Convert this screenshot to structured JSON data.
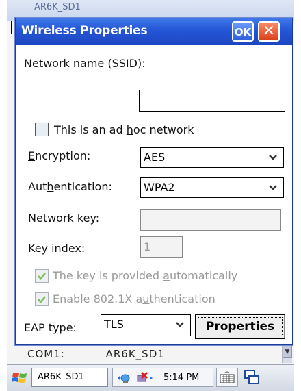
{
  "background_window": {
    "title": "AR6K_SD1",
    "list_row": [
      "COM1:",
      "AR6K_SD1"
    ]
  },
  "dialog": {
    "title": "Wireless Properties",
    "ok_label": "OK",
    "close_glyph": "✕",
    "ssid_label_pre": "Network ",
    "ssid_label_u": "n",
    "ssid_label_post": "ame (SSID):",
    "ssid_value": "",
    "adhoc_pre": "This is an ad ",
    "adhoc_u": "h",
    "adhoc_post": "oc network",
    "adhoc_checked": false,
    "encryption_u": "E",
    "encryption_post": "ncryption:",
    "encryption_value": "AES",
    "auth_pre": "Aut",
    "auth_u": "h",
    "auth_post": "entication:",
    "auth_value": "WPA2",
    "netkey_pre": "Network ",
    "netkey_u": "k",
    "netkey_post": "ey:",
    "netkey_value": "",
    "keyindex_pre": "Key inde",
    "keyindex_u": "x",
    "keyindex_post": ":",
    "keyindex_value": "1",
    "auto_pre": "The key is provided ",
    "auto_u": "a",
    "auto_post": "utomatically",
    "auto_checked": true,
    "eap8021x_pre": "Enable 802.1X a",
    "eap8021x_u": "u",
    "eap8021x_post": "thentication",
    "eap8021x_checked": true,
    "eaptype_label": "EAP type:",
    "eaptype_value": "TLS",
    "properties_u": "P",
    "properties_post": "roperties"
  },
  "taskbar": {
    "task_label": "AR6K_SD1",
    "time": "5:14 PM"
  },
  "colors": {
    "title_blue": "#2456d6",
    "disabled_text": "#9a9a9a",
    "check_green": "#7bbf5a"
  }
}
